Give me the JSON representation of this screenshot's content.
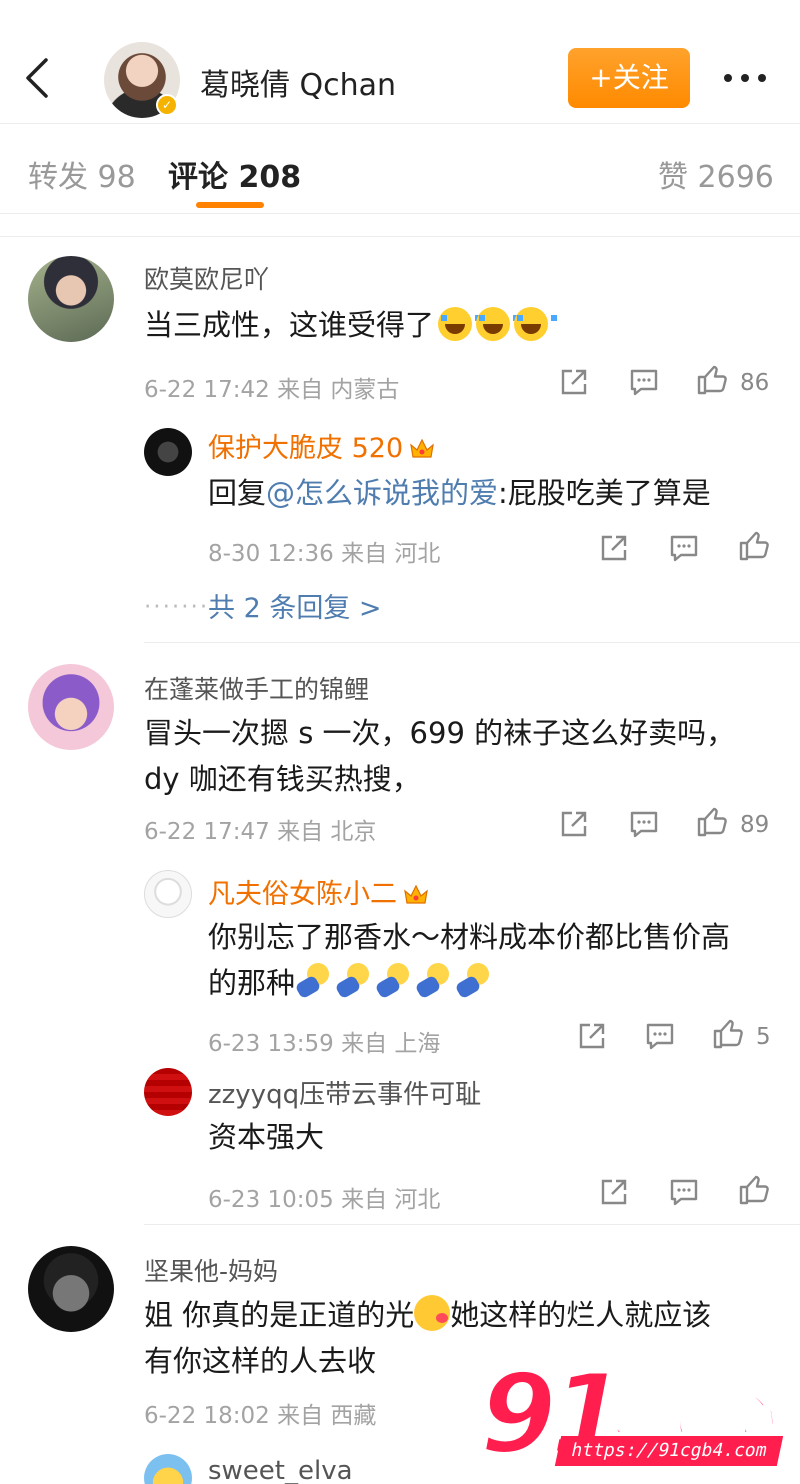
{
  "header": {
    "back_label": "",
    "name": "葛晓倩 Qchan",
    "follow_label": "+关注"
  },
  "tabs": {
    "repost": "转发 98",
    "comment": "评论 208",
    "like": "赞 2696"
  },
  "comments": [
    {
      "user": "欧莫欧尼吖",
      "text": "当三成性，这谁受得了",
      "meta": "6-22 17:42 来自 内蒙古",
      "likes": "86",
      "replies": [
        {
          "user": "保护大脆皮 520",
          "text_prefix": "回复",
          "mention": "@怎么诉说我的爱",
          "text": ":屁股吃美了算是",
          "meta": "8-30 12:36 来自 河北"
        }
      ],
      "more_replies": "共 2 条回复 >"
    },
    {
      "user": "在蓬莱做手工的锦鲤",
      "text_line1": "冒头一次摁 s 一次，699 的袜子这么好卖吗，",
      "text_line2": "dy 咖还有钱买热搜，",
      "meta": "6-22 17:47 来自 北京",
      "likes": "89",
      "replies": [
        {
          "user": "凡夫俗女陈小二",
          "text_line1": "你别忘了那香水～材料成本价都比售价高",
          "text_line2": "的那种",
          "meta": "6-23 13:59 来自 上海",
          "likes": "5"
        },
        {
          "user": "zzyyqq压带云事件可耻",
          "text": "资本强大",
          "meta": "6-23 10:05 来自 河北"
        }
      ]
    },
    {
      "user": "坚果他-妈妈",
      "text_line1a": "姐  你真的是正道的光",
      "text_line1b": "她这样的烂人就应该",
      "text_line2": "有你这样的人去收",
      "meta": "6-22 18:02 来自 西藏"
    },
    {
      "user": "sweet_elva"
    }
  ],
  "watermark": {
    "logo": "91",
    "title": "吃瓜中心",
    "url": "https://91cgb4.com"
  },
  "colors": {
    "accent": "#ff8200",
    "mention": "#507daf",
    "vip_name": "#f07000"
  }
}
